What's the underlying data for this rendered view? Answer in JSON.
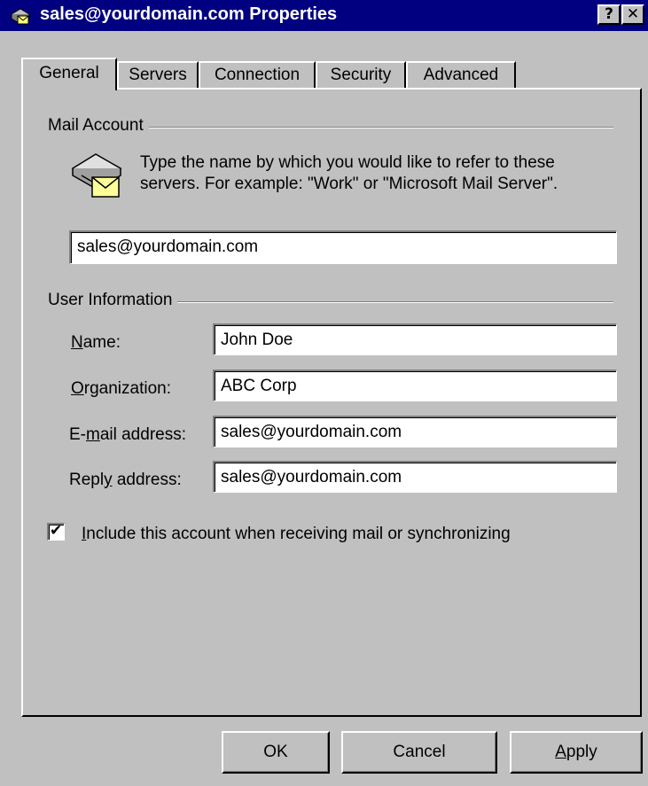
{
  "window": {
    "title": "sales@yourdomain.com Properties",
    "help_glyph": "?",
    "close_glyph": "✕"
  },
  "tabs": [
    {
      "label": "General",
      "active": true
    },
    {
      "label": "Servers",
      "active": false
    },
    {
      "label": "Connection",
      "active": false
    },
    {
      "label": "Security",
      "active": false
    },
    {
      "label": "Advanced",
      "active": false
    }
  ],
  "mail_account": {
    "group_label": "Mail Account",
    "description": "Type the name by which you would like to refer to these servers.  For example: \"Work\" or \"Microsoft Mail Server\".",
    "account_name": "sales@yourdomain.com"
  },
  "user_information": {
    "group_label": "User Information",
    "name": {
      "label_access": "N",
      "label_rest": "ame:",
      "value": "John Doe"
    },
    "organization": {
      "label_access": "O",
      "label_rest": "rganization:",
      "value": "ABC Corp"
    },
    "email": {
      "label_pre": "E-",
      "label_access": "m",
      "label_rest": "ail address:",
      "value": "sales@yourdomain.com"
    },
    "reply": {
      "label_pre": "Repl",
      "label_access": "y",
      "label_rest": " address:",
      "value": "sales@yourdomain.com"
    }
  },
  "include_account": {
    "checked": true,
    "check_glyph": "✔",
    "label_access": "I",
    "label_rest": "nclude this account when receiving mail or synchronizing"
  },
  "buttons": {
    "ok": "OK",
    "cancel": "Cancel",
    "apply_access": "A",
    "apply_rest": "pply"
  },
  "colors": {
    "titlebar": "#000080",
    "face": "#c0c0c0"
  }
}
